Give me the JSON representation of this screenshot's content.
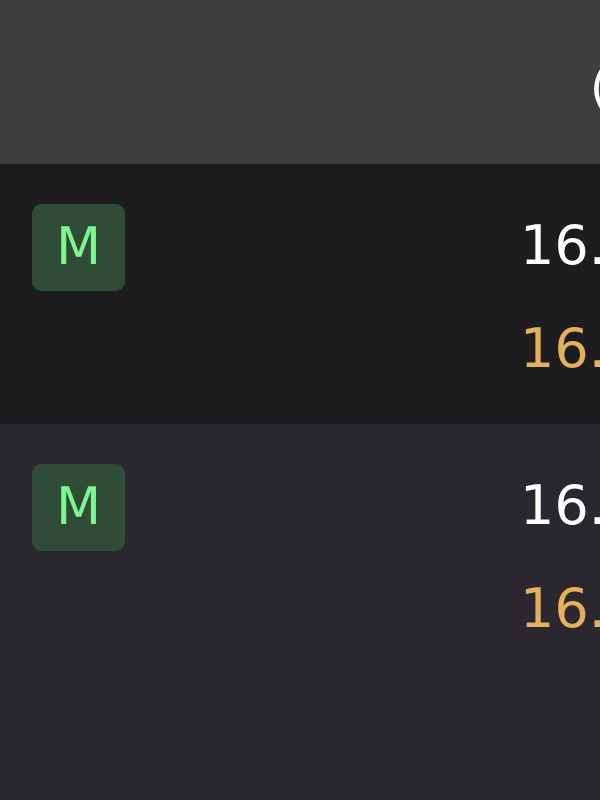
{
  "header": {
    "partial_text": "("
  },
  "rows": [
    {
      "badge": "M",
      "primary_value": "16.",
      "secondary_value": "16."
    },
    {
      "badge": "M",
      "primary_value": "16.",
      "secondary_value": "16."
    }
  ],
  "colors": {
    "header_bg": "#3e3d40",
    "row_dark_bg": "#1d1c1f",
    "row_light_bg": "#2a272e",
    "badge_bg": "#2f4c37",
    "badge_text": "#7ef58f",
    "primary_text": "#ffffff",
    "secondary_text": "#e5b05c"
  }
}
